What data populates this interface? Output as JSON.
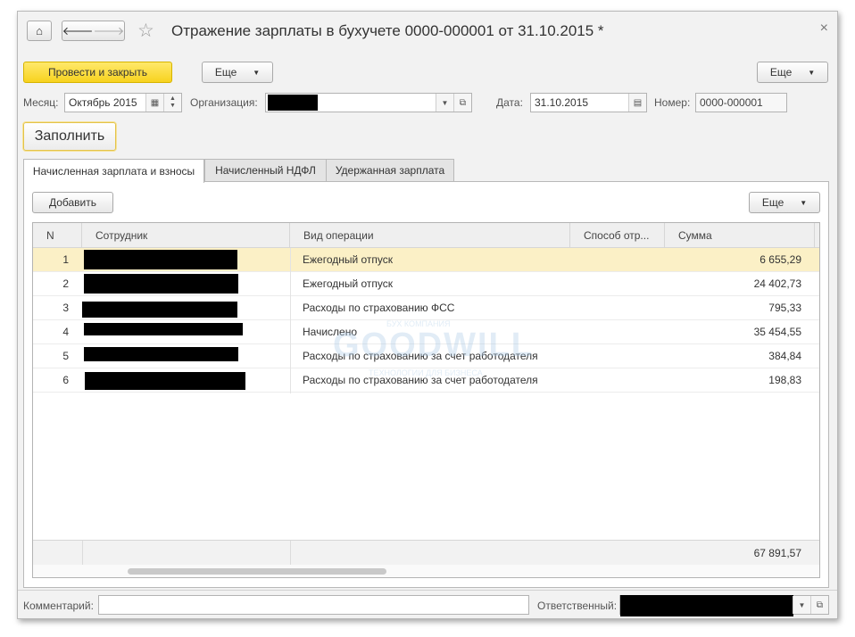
{
  "window": {
    "title": "Отражение зарплаты в бухучете 0000-000001 от 31.10.2015 *",
    "close_glyph": "×"
  },
  "toolbar": {
    "home_icon": "⌂",
    "back_icon": "🡐",
    "forward_icon": "🡒",
    "favorite_icon": "☆",
    "post_and_close_label": "Провести и закрыть",
    "more_label": "Еще",
    "more_right_label": "Еще"
  },
  "form": {
    "month_label": "Месяц:",
    "month_value": "Октябрь 2015",
    "org_label": "Организация:",
    "org_value": "",
    "date_label": "Дата:",
    "date_value": "31.10.2015",
    "number_label": "Номер:",
    "number_value": "0000-000001",
    "fill_label": "Заполнить"
  },
  "tabs": [
    {
      "label": "Начисленная зарплата и взносы",
      "active": true
    },
    {
      "label": "Начисленный НДФЛ",
      "active": false
    },
    {
      "label": "Удержанная зарплата",
      "active": false
    }
  ],
  "table_toolbar": {
    "add_label": "Добавить",
    "more_label": "Еще"
  },
  "table": {
    "columns": [
      "N",
      "Сотрудник",
      "Вид операции",
      "Способ отр...",
      "Сумма"
    ],
    "rows": [
      {
        "n": "1",
        "employee": "",
        "operation": "Ежегодный отпуск",
        "method": "",
        "sum": "6 655,29"
      },
      {
        "n": "2",
        "employee": "",
        "operation": "Ежегодный отпуск",
        "method": "",
        "sum": "24 402,73"
      },
      {
        "n": "3",
        "employee": "",
        "operation": "Расходы по страхованию ФСС",
        "method": "",
        "sum": "795,33"
      },
      {
        "n": "4",
        "employee": "",
        "operation": "Начислено",
        "method": "",
        "sum": "35 454,55"
      },
      {
        "n": "5",
        "employee": "",
        "operation": "Расходы по страхованию за счет работодателя",
        "method": "",
        "sum": "384,84"
      },
      {
        "n": "6",
        "employee": "",
        "operation": "Расходы по страхованию за счет работодателя",
        "method": "",
        "sum": "198,83"
      }
    ],
    "selected_row": 1,
    "total": "67 891,57"
  },
  "watermark": {
    "top": "БУХ КОМПАНИЯ",
    "main": "GOODWILL",
    "bottom": "ТЕХНОЛОГИИ ДЛЯ БИЗНЕСА"
  },
  "bottom": {
    "comment_label": "Комментарий:",
    "comment_value": "",
    "responsible_label": "Ответственный:",
    "responsible_value": ""
  },
  "colors": {
    "accent_button": "#f7d21e",
    "selected_row": "#fbf0c6"
  }
}
